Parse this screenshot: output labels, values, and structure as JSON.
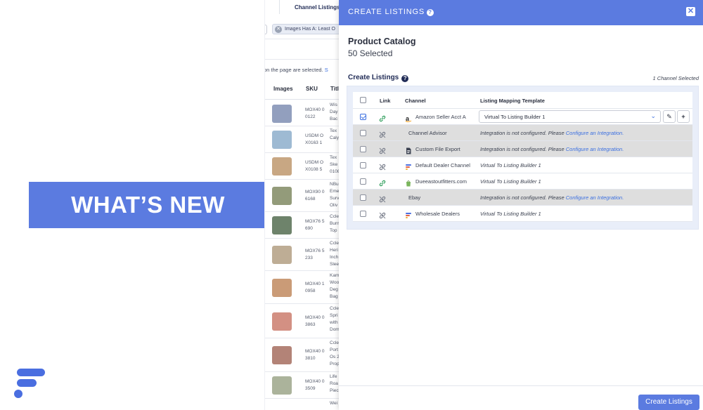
{
  "promo": {
    "title": "WHAT’S NEW"
  },
  "background_app": {
    "tab_label": "Channel Listings",
    "filter_chip": "Images Has A: Least O",
    "selected_note": "on the page are selected.",
    "selected_note_link": "S",
    "columns": [
      "Images",
      "SKU",
      "Titl"
    ],
    "rows": [
      {
        "sku": "MOX40 00122",
        "title": [
          "Wis",
          "Day",
          "Bac"
        ]
      },
      {
        "sku": "USDM OX0163 1",
        "title": [
          "Tex",
          "Caly"
        ]
      },
      {
        "sku": "USDM OX0108 5",
        "title": [
          "Tex",
          "Ske",
          "0108"
        ]
      },
      {
        "sku": "MOX90 06168",
        "title": [
          "NBu",
          "Eme",
          "Surv",
          "Oliv"
        ]
      },
      {
        "sku": "MOX76 5690",
        "title": [
          "Ccle",
          "Burn",
          "Top"
        ]
      },
      {
        "sku": "MOX76 5233",
        "title": [
          "Ccle",
          "Heri",
          "Inch",
          "Slee"
        ]
      },
      {
        "sku": "MOX40 10958",
        "title": [
          "Kam",
          "Woo",
          "Deg",
          "Bag"
        ]
      },
      {
        "sku": "MOX40 03863",
        "title": [
          "Ccle",
          "Spri",
          "with",
          "Dom"
        ]
      },
      {
        "sku": "MOX40 03810",
        "title": [
          "Ccle",
          "Port",
          "Os 2",
          "Prop"
        ]
      },
      {
        "sku": "MOX40 03509",
        "title": [
          "Life",
          "Roa",
          "Piec"
        ]
      },
      {
        "sku": "",
        "title": [
          "Wei"
        ]
      }
    ]
  },
  "modal": {
    "title": "CREATE LISTINGS",
    "catalog_title": "Product Catalog",
    "catalog_count": "50 Selected",
    "section_heading": "Create Listings",
    "channel_count": "1 Channel Selected",
    "columns": {
      "link": "Link",
      "channel": "Channel",
      "template": "Listing Mapping Template"
    },
    "not_configured_text": "Integration is not configured. Please",
    "configure_link": "Configure an Integration.",
    "selected_template": "Virtual To Listing Builder 1",
    "rows": [
      {
        "channel": "Amazon Seller Acct A",
        "icon": "amazon-icon",
        "checked": true,
        "linked": true,
        "configured": true,
        "template": "Virtual To Listing Builder 1"
      },
      {
        "channel": "Channel Advisor",
        "icon": "none",
        "checked": false,
        "linked": false,
        "configured": false
      },
      {
        "channel": "Custom File Export",
        "icon": "document-icon",
        "checked": false,
        "linked": false,
        "configured": false
      },
      {
        "channel": "Default Dealer Channel",
        "icon": "brand-stripes-icon",
        "checked": false,
        "linked": false,
        "configured": true,
        "template": "Virtual To Listing Builder 1"
      },
      {
        "channel": "Dueeastoutfitters.com",
        "icon": "shopify-icon",
        "checked": false,
        "linked": true,
        "configured": true,
        "template": "Virtual To Listing Builder 1"
      },
      {
        "channel": "Ebay",
        "icon": "none",
        "checked": false,
        "linked": false,
        "configured": false
      },
      {
        "channel": "Wholesale Dealers",
        "icon": "brand-stripes-icon",
        "checked": false,
        "linked": false,
        "configured": true,
        "template": "Virtual To Listing Builder 1"
      }
    ],
    "submit_label": "Create Listings"
  },
  "colors": {
    "accent": "#5b7be0",
    "link": "#3b6fe0",
    "disabled_row": "#dedede",
    "panel_bg": "#e9eef9",
    "linked_green": "#2e9e5b"
  }
}
